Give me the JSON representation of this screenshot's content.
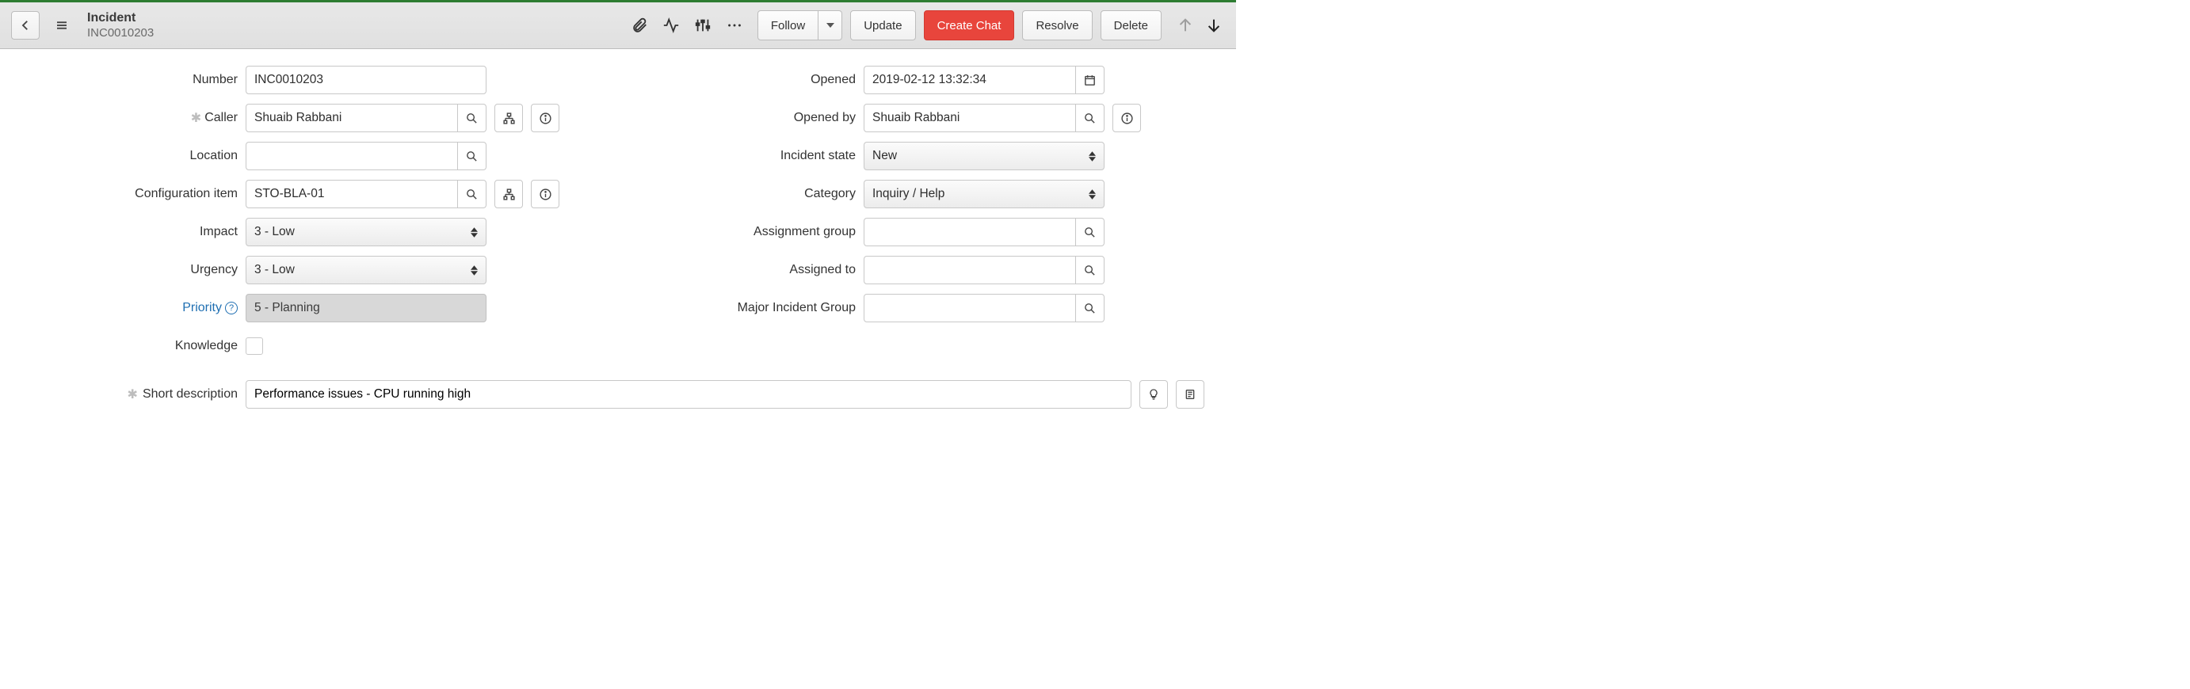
{
  "header": {
    "title": "Incident",
    "record_id": "INC0010203",
    "buttons": {
      "follow": "Follow",
      "update": "Update",
      "create_chat": "Create Chat",
      "resolve": "Resolve",
      "delete": "Delete"
    }
  },
  "left": {
    "number": {
      "label": "Number",
      "value": "INC0010203"
    },
    "caller": {
      "label": "Caller",
      "value": "Shuaib Rabbani"
    },
    "location": {
      "label": "Location",
      "value": ""
    },
    "ci": {
      "label": "Configuration item",
      "value": "STO-BLA-01"
    },
    "impact": {
      "label": "Impact",
      "value": "3 - Low"
    },
    "urgency": {
      "label": "Urgency",
      "value": "3 - Low"
    },
    "priority": {
      "label": "Priority",
      "value": "5 - Planning"
    },
    "knowledge": {
      "label": "Knowledge"
    }
  },
  "right": {
    "opened": {
      "label": "Opened",
      "value": "2019-02-12 13:32:34"
    },
    "opened_by": {
      "label": "Opened by",
      "value": "Shuaib Rabbani"
    },
    "state": {
      "label": "Incident state",
      "value": "New"
    },
    "category": {
      "label": "Category",
      "value": "Inquiry / Help"
    },
    "assignment_group": {
      "label": "Assignment group",
      "value": ""
    },
    "assigned_to": {
      "label": "Assigned to",
      "value": ""
    },
    "major_incident_group": {
      "label": "Major Incident Group",
      "value": ""
    }
  },
  "short_description": {
    "label": "Short description",
    "value": "Performance issues - CPU running high"
  }
}
